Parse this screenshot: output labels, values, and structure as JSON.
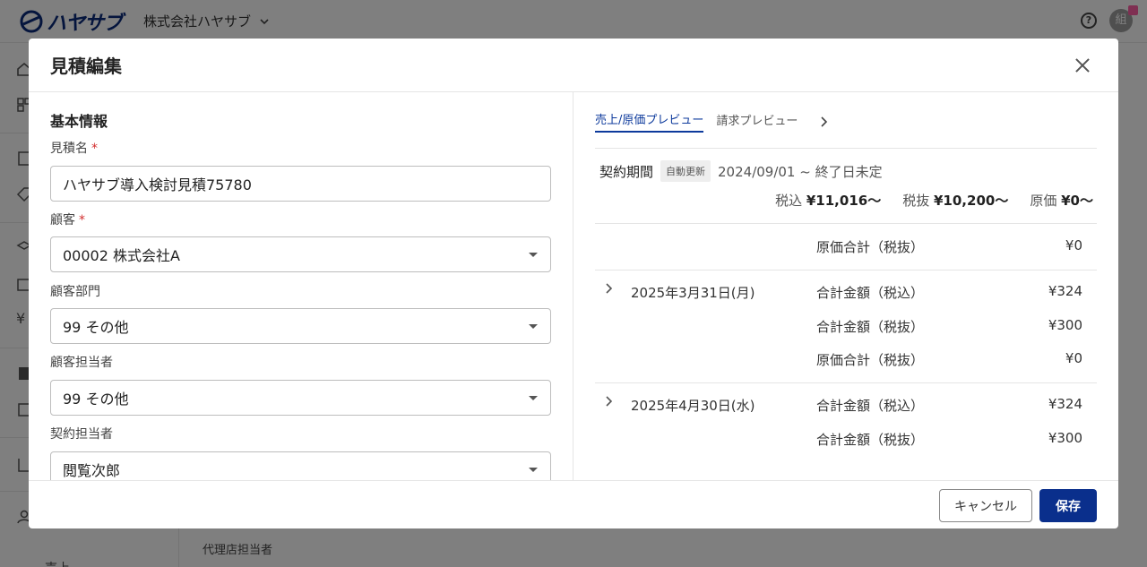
{
  "app": {
    "logo_text": "ハヤサブ",
    "company": "株式会社ハヤサブ",
    "help_icon": "?",
    "avatar_initial": "組",
    "bg_field_label": "代理店担当者",
    "bg_nav_label": "売上"
  },
  "modal": {
    "title": "見積編集",
    "left": {
      "section_title": "基本情報",
      "fields": [
        {
          "label": "見積名",
          "required": "*",
          "value": "ハヤサブ導入検討見積75780",
          "type": "text"
        },
        {
          "label": "顧客",
          "required": "*",
          "value": "00002 株式会社A",
          "type": "select"
        },
        {
          "label": "顧客部門",
          "required": "",
          "value": "99 その他",
          "type": "select"
        },
        {
          "label": "顧客担当者",
          "required": "",
          "value": "99 その他",
          "type": "select"
        },
        {
          "label": "契約担当者",
          "required": "",
          "value": "閲覧次郎",
          "type": "select"
        }
      ]
    },
    "right": {
      "tabs": [
        {
          "label": "売上/原価プレビュー",
          "active": true
        },
        {
          "label": "請求プレビュー",
          "active": false
        }
      ],
      "contract": {
        "label": "契約期間",
        "badge": "自動更新",
        "dates": "2024/09/01 ~ 終了日未定"
      },
      "totals": {
        "tax_incl_label": "税込",
        "tax_incl_value": "¥11,016〜",
        "tax_excl_label": "税抜",
        "tax_excl_value": "¥10,200〜",
        "cost_label": "原価",
        "cost_value": "¥0〜"
      },
      "summary_row": {
        "label": "原価合計（税抜）",
        "value": "¥0"
      },
      "periods": [
        {
          "date": "2025年3月31日(月)",
          "lines": [
            {
              "label": "合計金額（税込）",
              "value": "¥324"
            },
            {
              "label": "合計金額（税抜）",
              "value": "¥300"
            },
            {
              "label": "原価合計（税抜）",
              "value": "¥0"
            }
          ]
        },
        {
          "date": "2025年4月30日(水)",
          "lines": [
            {
              "label": "合計金額（税込）",
              "value": "¥324"
            },
            {
              "label": "合計金額（税抜）",
              "value": "¥300"
            }
          ]
        }
      ]
    },
    "footer": {
      "cancel_label": "キャンセル",
      "save_label": "保存"
    }
  }
}
